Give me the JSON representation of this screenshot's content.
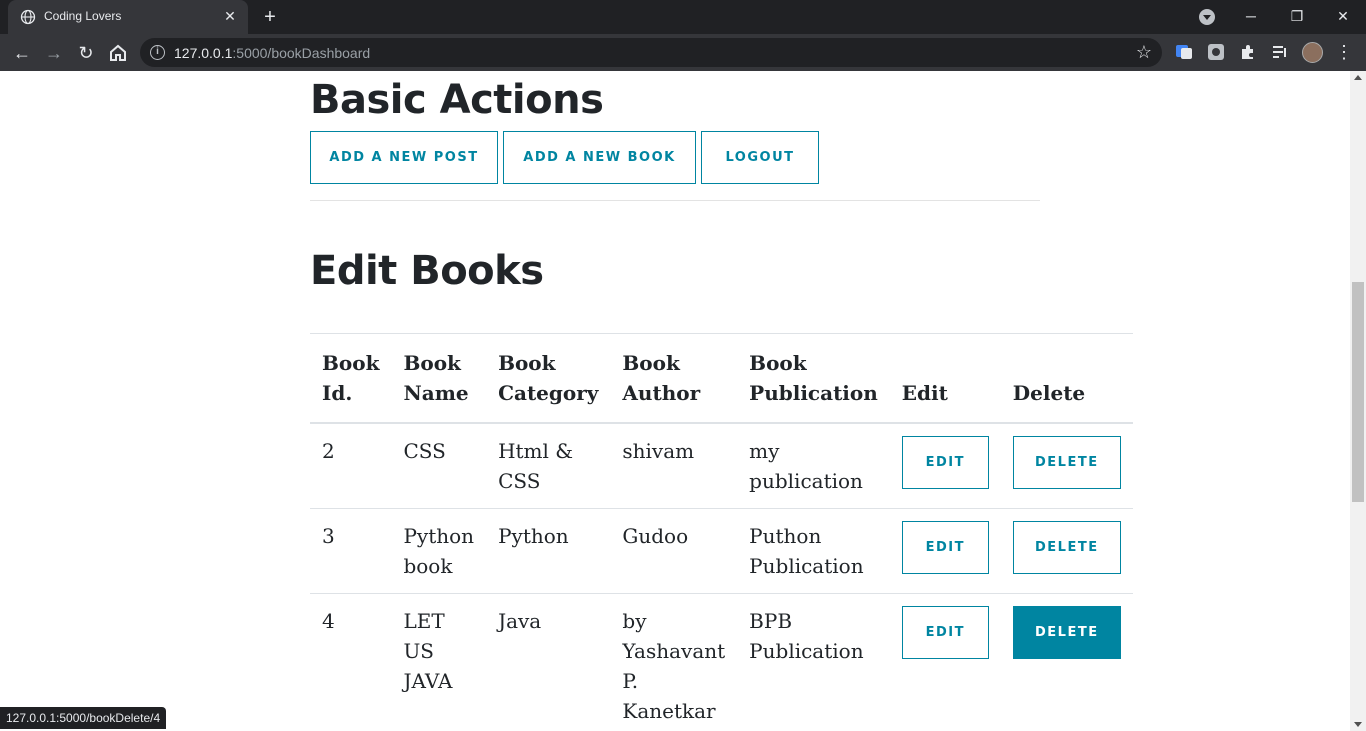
{
  "browser": {
    "tab_title": "Coding Lovers",
    "url_host": "127.0.0.1",
    "url_rest": ":5000/bookDashboard",
    "status_url": "127.0.0.1:5000/bookDelete/4"
  },
  "basic": {
    "title": "Basic Actions",
    "buttons": [
      "ADD A NEW POST",
      "ADD A NEW BOOK",
      "LOGOUT"
    ]
  },
  "books": {
    "title": "Edit Books",
    "headers": [
      [
        "Book",
        "Id."
      ],
      [
        "Book",
        "Name"
      ],
      [
        "Book",
        "Category"
      ],
      [
        "Book",
        "Author"
      ],
      [
        "Book",
        "Publication"
      ],
      [
        "",
        "Edit"
      ],
      [
        "",
        "Delete"
      ]
    ],
    "edit_label": "EDIT",
    "delete_label": "DELETE",
    "rows": [
      {
        "id": "2",
        "name": "CSS",
        "category": "Html & CSS",
        "author": "shivam",
        "publication": "my publication",
        "delete_active": false
      },
      {
        "id": "3",
        "name": "Python book",
        "category": "Python",
        "author": "Gudoo",
        "publication": "Puthon Publication",
        "delete_active": false
      },
      {
        "id": "4",
        "name": "LET US JAVA",
        "category": "Java",
        "author": "by Yashavant P. Kanetkar",
        "publication": "BPB Publication",
        "delete_active": true
      }
    ]
  },
  "colors": {
    "accent": "#0085a1",
    "text": "#212529",
    "chrome_dark": "#202124",
    "chrome_mid": "#35363a"
  }
}
